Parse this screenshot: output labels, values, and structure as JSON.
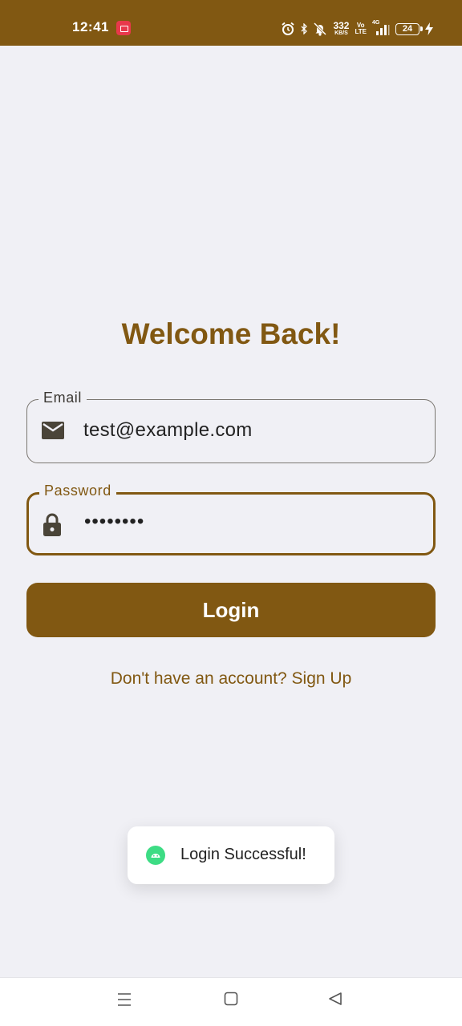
{
  "status_bar": {
    "time": "12:41",
    "net_speed_value": "332",
    "net_speed_unit": "KB/S",
    "volte_top": "Vo",
    "volte_bottom": "LTE",
    "network_type": "4G",
    "battery_level": "24",
    "icons": [
      "screen-record-icon",
      "alarm-icon",
      "bluetooth-icon",
      "mute-icon",
      "signal-icon",
      "battery-icon",
      "charging-icon"
    ],
    "color": "#815812"
  },
  "login": {
    "title": "Welcome Back!",
    "email": {
      "label": "Email",
      "value": "test@example.com",
      "icon": "envelope-icon"
    },
    "password": {
      "label": "Password",
      "value": "••••••••",
      "icon": "lock-icon"
    },
    "login_button": "Login",
    "signup_link": "Don't have an account? Sign Up",
    "accent_color": "#815812"
  },
  "toast": {
    "message": "Login Successful!",
    "icon": "android-icon"
  },
  "nav_bar": {
    "buttons": [
      "menu-icon",
      "home-icon",
      "back-icon"
    ]
  }
}
